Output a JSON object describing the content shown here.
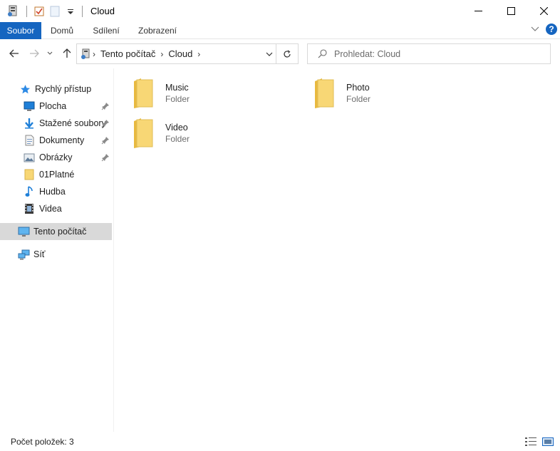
{
  "window": {
    "title": "Cloud"
  },
  "ribbon": {
    "tabs": [
      "Soubor",
      "Domů",
      "Sdílení",
      "Zobrazení"
    ],
    "help_label": "?"
  },
  "address": {
    "breadcrumb": [
      "Tento počítač",
      "Cloud"
    ]
  },
  "search": {
    "placeholder": "Prohledat: Cloud"
  },
  "sidebar": {
    "quick_access": "Rychlý přístup",
    "items": [
      {
        "label": "Plocha",
        "icon": "desktop-icon",
        "pinned": true
      },
      {
        "label": "Stažené soubory",
        "icon": "download-icon",
        "pinned": true
      },
      {
        "label": "Dokumenty",
        "icon": "documents-icon",
        "pinned": true
      },
      {
        "label": "Obrázky",
        "icon": "pictures-icon",
        "pinned": true
      },
      {
        "label": "01Platné",
        "icon": "folder-icon",
        "pinned": false
      },
      {
        "label": "Hudba",
        "icon": "music-icon",
        "pinned": false
      },
      {
        "label": "Videa",
        "icon": "video-icon",
        "pinned": false
      }
    ],
    "this_pc": "Tento počítač",
    "network": "Síť"
  },
  "content": {
    "items": [
      {
        "name": "Music",
        "type": "Folder"
      },
      {
        "name": "Photo",
        "type": "Folder"
      },
      {
        "name": "Video",
        "type": "Folder"
      }
    ]
  },
  "status": {
    "item_count": "Počet položek: 3"
  },
  "colors": {
    "accent": "#1565c0",
    "folder": "#f8d775",
    "selected": "#d9d9d9"
  }
}
